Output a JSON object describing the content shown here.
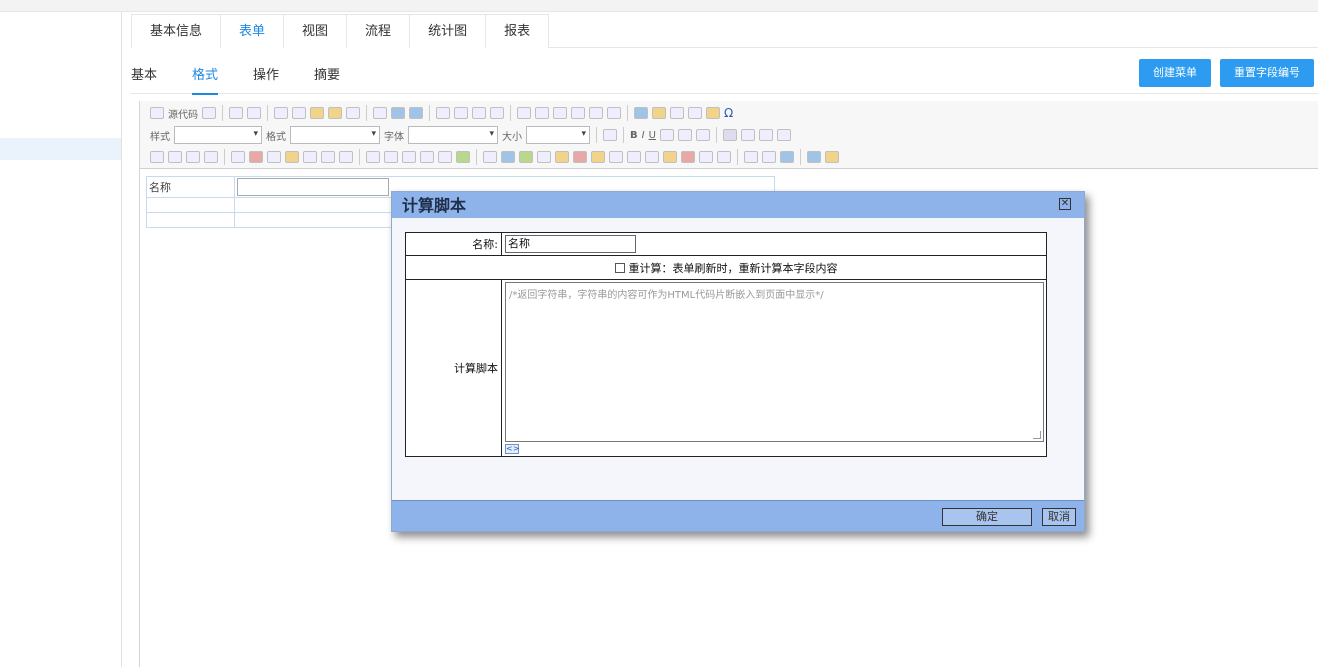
{
  "main_tabs": [
    {
      "label": "基本信息"
    },
    {
      "label": "表单"
    },
    {
      "label": "视图"
    },
    {
      "label": "流程"
    },
    {
      "label": "统计图"
    },
    {
      "label": "报表"
    }
  ],
  "sub_tabs": [
    {
      "label": "基本"
    },
    {
      "label": "格式"
    },
    {
      "label": "操作"
    },
    {
      "label": "摘要"
    }
  ],
  "actions": {
    "create_menu": "创建菜单",
    "reset_field_number": "重置字段编号"
  },
  "toolbar": {
    "source": "源代码",
    "style_label": "样式",
    "format_label": "格式",
    "font_label": "字体",
    "size_label": "大小",
    "bold": "B",
    "italic": "I",
    "underline": "U",
    "omega": "Ω"
  },
  "form": {
    "name_label": "名称"
  },
  "dialog": {
    "title": "计算脚本",
    "name_label": "名称:",
    "name_value": "名称",
    "recalc_label": "重计算：表单刷新时，重新计算本字段内容",
    "script_label": "计算脚本",
    "script_placeholder": "/*返回字符串，字符串的内容可作为HTML代码片断嵌入到页面中显示*/",
    "ok_label": "确定",
    "cancel_label": "取消"
  }
}
